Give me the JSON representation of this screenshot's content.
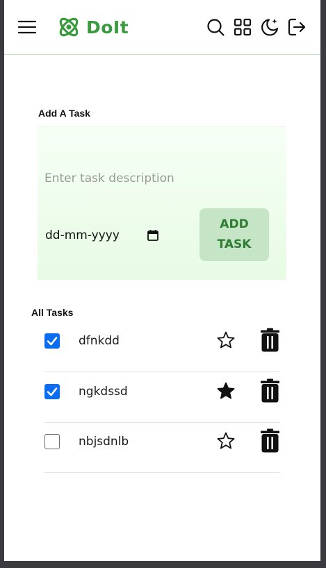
{
  "header": {
    "app_name": "DoIt",
    "brand_color": "#3a9a3e",
    "icons": [
      "menu-icon",
      "logo-icon",
      "search-icon",
      "grid-view-icon",
      "theme-toggle-icon",
      "logout-icon"
    ]
  },
  "add_task": {
    "title": "Add A Task",
    "input_placeholder": "Enter task description",
    "input_value": "",
    "date_placeholder": "dd-mm-yyyy",
    "button_label": "ADD\nTASK"
  },
  "task_list": {
    "title": "All Tasks",
    "tasks": [
      {
        "text": "dfnkdd",
        "completed": true,
        "starred": false
      },
      {
        "text": "ngkdssd",
        "completed": true,
        "starred": true
      },
      {
        "text": "nbjsdnlb",
        "completed": false,
        "starred": false
      }
    ]
  },
  "colors": {
    "accent": "#3a9a3e",
    "panel_bg": "#e7fbe4",
    "button_bg": "#c6e4c6",
    "checkbox_checked": "#0a6cf0"
  }
}
